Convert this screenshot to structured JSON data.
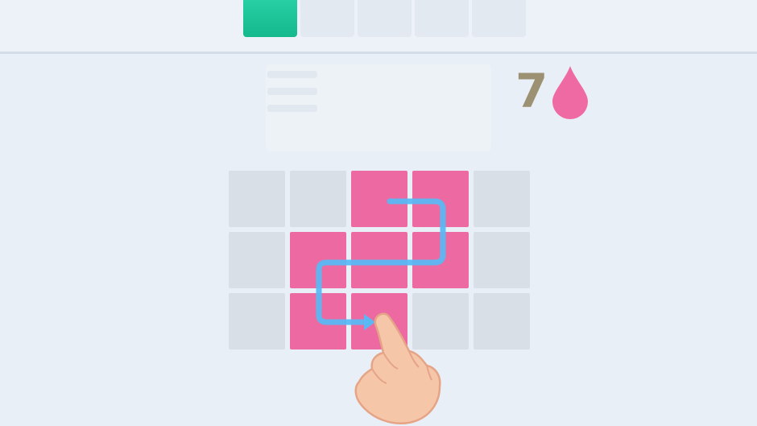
{
  "progress": {
    "total": 5,
    "completed": 1,
    "colors": {
      "done": "#1cc59a",
      "pending": "#e3e9f0"
    }
  },
  "moves": {
    "count": "7",
    "icon": "drop-icon",
    "icon_color": "#ef6aa2"
  },
  "board": {
    "rows": 3,
    "cols": 5,
    "colors": {
      "empty": "#d8dfe6",
      "filled": "#ec6aa1"
    },
    "cells": [
      [
        "empty",
        "empty",
        "pink",
        "pink",
        "empty"
      ],
      [
        "empty",
        "pink",
        "pink",
        "pink",
        "empty"
      ],
      [
        "empty",
        "pink",
        "pink",
        "empty",
        "empty"
      ]
    ]
  },
  "tutorial": {
    "path_icon": "swipe-path-arrow-icon",
    "hand_icon": "pointing-hand-icon",
    "path_color": "#5bb8f4"
  }
}
